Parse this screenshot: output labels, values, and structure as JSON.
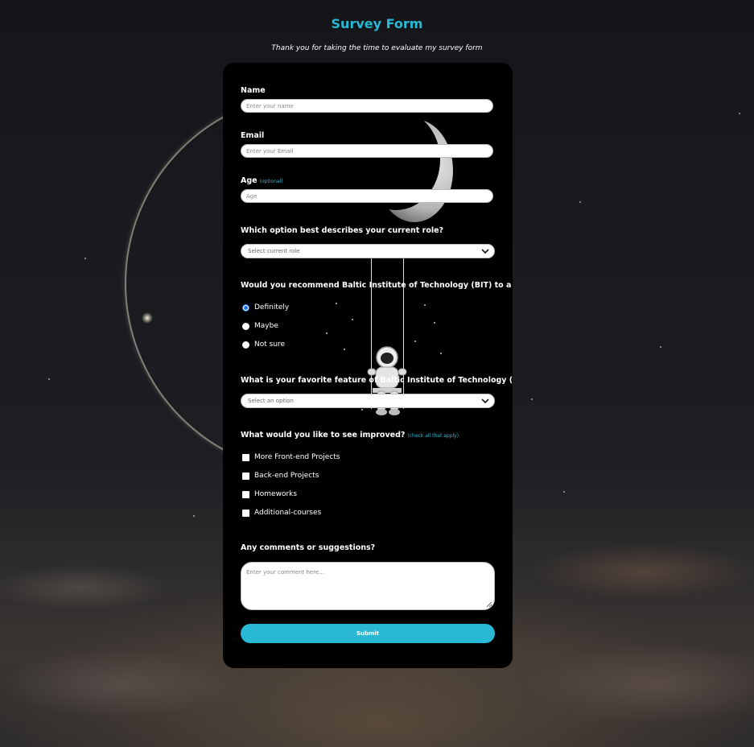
{
  "header": {
    "title": "Survey Form",
    "subtitle": "Thank you for taking the time to evaluate my survey form"
  },
  "form": {
    "name": {
      "label": "Name",
      "placeholder": "Enter your name"
    },
    "email": {
      "label": "Email",
      "placeholder": "Enter your Email"
    },
    "age": {
      "label": "Age",
      "hint": "(optional)",
      "placeholder": "Age"
    },
    "role": {
      "label": "Which option best describes your current role?",
      "selected": "Select current role"
    },
    "recommend": {
      "label": "Would you recommend Baltic Institute of Technology (BIT) to a friend?",
      "options": [
        {
          "label": "Definitely",
          "checked": true
        },
        {
          "label": "Maybe",
          "checked": false
        },
        {
          "label": "Not sure",
          "checked": false
        }
      ]
    },
    "feature": {
      "label": "What is your favorite feature of Baltic Institute of Technology (BIT)?",
      "selected": "Select an option"
    },
    "improve": {
      "label": "What would you like to see improved?",
      "hint": "(check all that apply)",
      "options": [
        {
          "label": "More Front-end Projects",
          "checked": false
        },
        {
          "label": "Back-end Projects",
          "checked": false
        },
        {
          "label": "Homeworks",
          "checked": false
        },
        {
          "label": "Additional-courses",
          "checked": false
        }
      ]
    },
    "comments": {
      "label": "Any comments or suggestions?",
      "placeholder": "Enter your comment here..."
    },
    "submit_label": "Submit"
  },
  "colors": {
    "accent": "#29b9d5",
    "card": "#000000",
    "radio_selected": "#1a73e8"
  },
  "icons": {
    "select_arrow": "chevron-down-icon",
    "decoration": "astronaut-on-moon-swing"
  }
}
